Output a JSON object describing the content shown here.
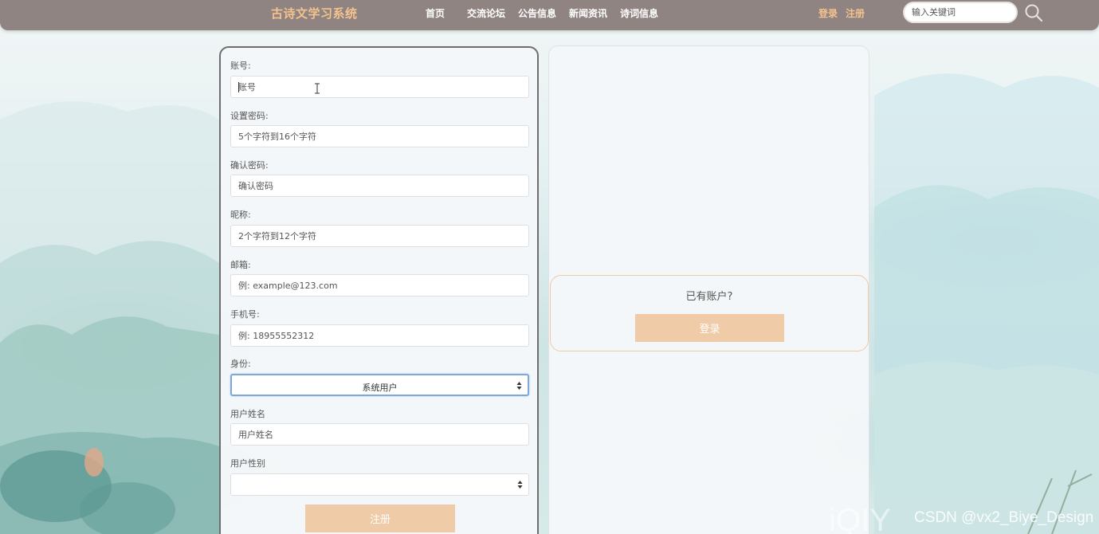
{
  "header": {
    "brand": "古诗文学习系统",
    "nav": [
      "首页",
      "交流论坛",
      "公告信息",
      "新闻资讯",
      "诗词信息"
    ],
    "login_link": "登录",
    "register_link": "注册",
    "search_placeholder": "输入关键词"
  },
  "register_form": {
    "fields": [
      {
        "label": "账号:",
        "placeholder": "账号"
      },
      {
        "label": "设置密码:",
        "placeholder": "5个字符到16个字符"
      },
      {
        "label": "确认密码:",
        "placeholder": "确认密码"
      },
      {
        "label": "昵称:",
        "placeholder": "2个字符到12个字符"
      },
      {
        "label": "邮箱:",
        "placeholder": "例: example@123.com"
      },
      {
        "label": "手机号:",
        "placeholder": "例: 18955552312"
      }
    ],
    "identity_label": "身份:",
    "identity_value": "系统用户",
    "name_label": "用户姓名",
    "name_placeholder": "用户姓名",
    "gender_label": "用户性别",
    "gender_value": "",
    "submit_label": "注册"
  },
  "login_panel": {
    "prompt": "已有账户?",
    "button_label": "登录"
  },
  "watermark": "CSDN @vx2_Biye_Design",
  "colors": {
    "header_bg": "#8f8481",
    "brand": "#f4c28f",
    "button_bg": "#f0cba8",
    "card_border": "#6e6e6e",
    "login_box_border": "#f0c9a6"
  }
}
